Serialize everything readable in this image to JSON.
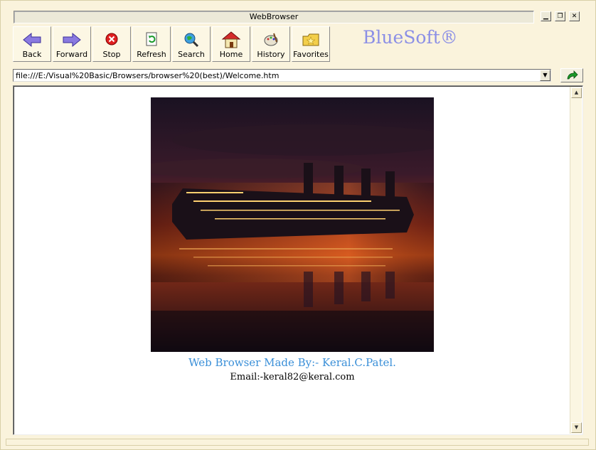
{
  "window": {
    "title": "WebBrowser",
    "caption_buttons": [
      {
        "name": "minimize",
        "glyph": "▁"
      },
      {
        "name": "maximize",
        "glyph": "❐"
      },
      {
        "name": "close",
        "glyph": "✕"
      }
    ]
  },
  "toolbar": {
    "buttons": [
      {
        "id": "back",
        "label": "Back",
        "icon": "back-arrow-icon"
      },
      {
        "id": "forward",
        "label": "Forward",
        "icon": "forward-arrow-icon"
      },
      {
        "id": "stop",
        "label": "Stop",
        "icon": "stop-icon"
      },
      {
        "id": "refresh",
        "label": "Refresh",
        "icon": "refresh-icon"
      },
      {
        "id": "search",
        "label": "Search",
        "icon": "search-globe-icon"
      },
      {
        "id": "home",
        "label": "Home",
        "icon": "home-icon"
      },
      {
        "id": "history",
        "label": "History",
        "icon": "history-icon"
      },
      {
        "id": "favorites",
        "label": "Favorites",
        "icon": "favorites-folder-icon"
      }
    ],
    "brand": "BlueSoft®"
  },
  "address_bar": {
    "url": "file:///E:/Visual%20Basic/Browsers/browser%20(best)/Welcome.htm",
    "dropdown_glyph": "▼"
  },
  "page": {
    "image_alt": "Ship at sunset reflected in water",
    "credit": "Web Browser Made By:- Keral.C.Patel.",
    "email": "Email:-keral82@keral.com"
  },
  "scrollbar": {
    "up": "▲",
    "down": "▼"
  },
  "colors": {
    "brand": "#8b8fe6",
    "credit": "#3a8fd8",
    "frame": "#faf3dc"
  }
}
